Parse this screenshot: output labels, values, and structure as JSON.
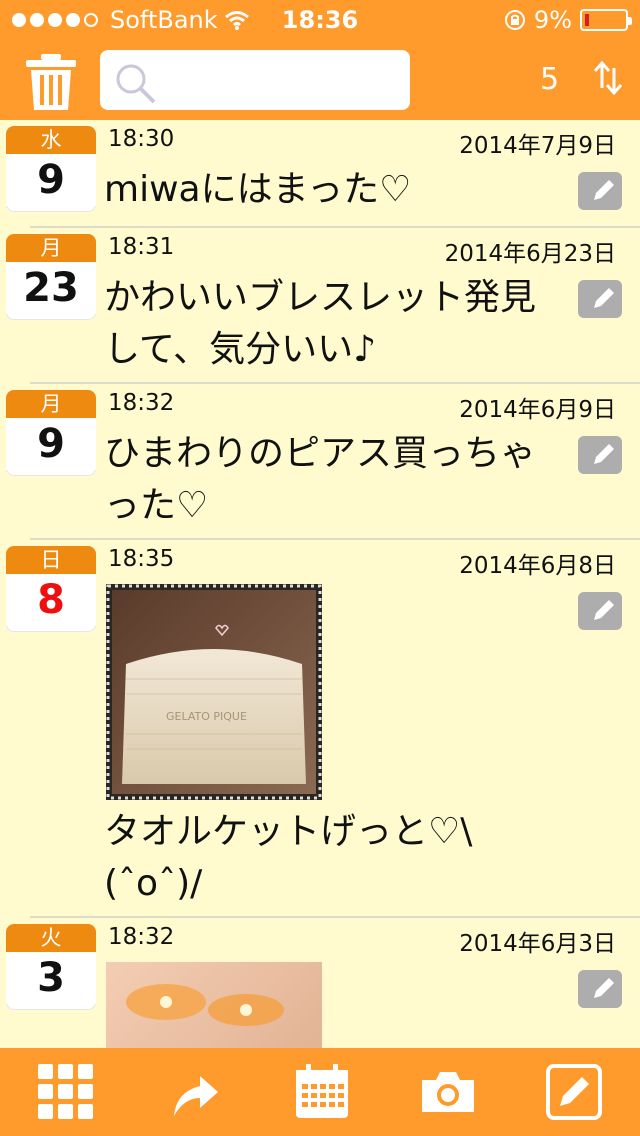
{
  "status": {
    "carrier": "SoftBank",
    "time": "18:36",
    "battery": "9%"
  },
  "nav": {
    "count": "5",
    "search_placeholder": "",
    "icons": [
      "trash-icon",
      "search-icon",
      "sort-icon"
    ]
  },
  "entries": [
    {
      "weekday": "水",
      "day": "9",
      "time": "18:30",
      "date": "2014年7月9日",
      "text": "miwaにはまった♡"
    },
    {
      "weekday": "月",
      "day": "23",
      "time": "18:31",
      "date": "2014年6月23日",
      "text": "かわいいブレスレット発見して、気分いい♪"
    },
    {
      "weekday": "月",
      "day": "9",
      "time": "18:32",
      "date": "2014年6月9日",
      "text": "ひまわりのピアス買っちゃった♡"
    },
    {
      "weekday": "日",
      "day": "8",
      "time": "18:35",
      "date": "2014年6月8日",
      "photo_text": "GELATO PIQUE",
      "text": "タオルケットげっと♡\\(ˆoˆ)/"
    },
    {
      "weekday": "火",
      "day": "3",
      "time": "18:32",
      "date": "2014年6月3日",
      "text": ""
    }
  ],
  "colors": {
    "accent": "#FF9A2C",
    "background": "#FFFBCF",
    "calendar_header": "#EE8A10",
    "sunday": "#EE1010",
    "edit_icon": "#ADADAD"
  },
  "toolbar": {
    "icons": [
      "grid-icon",
      "share-icon",
      "calendar-icon",
      "camera-icon",
      "compose-icon"
    ]
  }
}
